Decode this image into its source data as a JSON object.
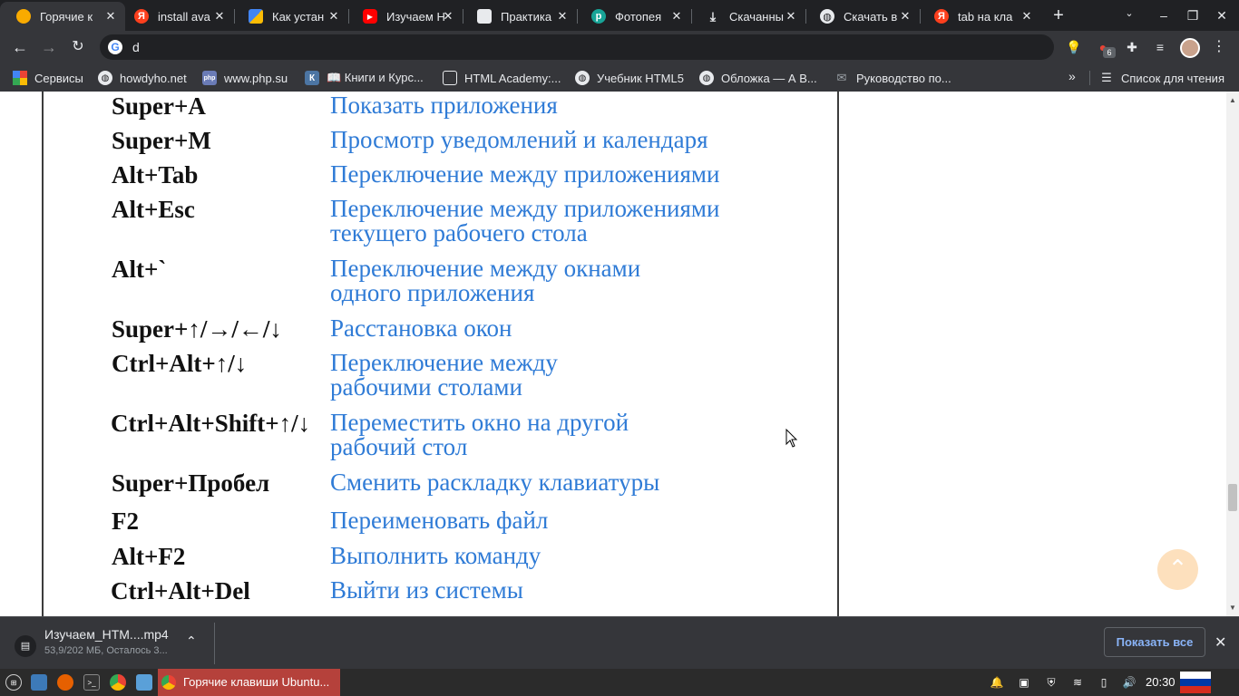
{
  "browser": {
    "tabs": [
      {
        "title": "Горячие к",
        "favicon": "bulb-icon",
        "active": true
      },
      {
        "title": "install ava",
        "favicon": "yandex-icon"
      },
      {
        "title": "Как устан",
        "favicon": "grid-icon"
      },
      {
        "title": "Изучаем H",
        "favicon": "youtube-icon"
      },
      {
        "title": "Практика",
        "favicon": "slides-icon"
      },
      {
        "title": "Фотопея",
        "favicon": "photopea-icon"
      },
      {
        "title": "Скачанны",
        "favicon": "download-icon"
      },
      {
        "title": "Скачать в",
        "favicon": "globe-icon"
      },
      {
        "title": "tab на кла",
        "favicon": "yandex-icon"
      }
    ],
    "address": "d",
    "extension_badge": "6",
    "bookmarks": [
      {
        "label": "Сервисы",
        "icon": "apps-grid-icon"
      },
      {
        "label": "howdyho.net",
        "icon": "globe-icon"
      },
      {
        "label": "www.php.su",
        "icon": "php-icon"
      },
      {
        "label": "📖 Книги и Курс...",
        "icon": "vk-icon"
      },
      {
        "label": "HTML Academy:...",
        "icon": "academy-icon"
      },
      {
        "label": "Учебник HTML5",
        "icon": "globe-icon"
      },
      {
        "label": "Обложка — А В...",
        "icon": "globe-icon"
      },
      {
        "label": "Руководство по...",
        "icon": "mail-icon"
      }
    ],
    "reading_list": "Список для чтения"
  },
  "shortcuts": [
    {
      "key": "Super+A",
      "desc": [
        "Показать приложения"
      ]
    },
    {
      "key": "Super+M",
      "desc": [
        "Просмотр уведомлений и календаря"
      ]
    },
    {
      "key": "Alt+Tab",
      "desc": [
        "Переключение между приложениями"
      ]
    },
    {
      "key": "Alt+Esc",
      "desc": [
        "Переключение между приложениями",
        "текущего рабочего стола"
      ]
    },
    {
      "key": "Alt+`",
      "desc": [
        "Переключение между окнами",
        "одного приложения"
      ]
    },
    {
      "key": "Super+↑/→/←/↓",
      "desc": [
        "Расстановка окон"
      ]
    },
    {
      "key": "Ctrl+Alt+↑/↓",
      "desc": [
        "Переключение между",
        "рабочими столами"
      ]
    },
    {
      "key": "Ctrl+Alt+Shift+↑/↓",
      "desc": [
        "Переместить окно на другой",
        "рабочий стол"
      ]
    },
    {
      "key": "Super+Пробел",
      "desc": [
        "Сменить раскладку клавиатуры"
      ]
    },
    {
      "key": "F2",
      "desc": [
        "Переименовать файл"
      ]
    },
    {
      "key": "Alt+F2",
      "desc": [
        "Выполнить команду"
      ]
    },
    {
      "key": "Ctrl+Alt+Del",
      "desc": [
        "Выйти из системы"
      ]
    }
  ],
  "download": {
    "filename": "Изучаем_HTM....mp4",
    "status": "53,9/202 МБ, Осталось 3...",
    "show_all": "Показать все"
  },
  "taskbar": {
    "active_window": "Горячие клавиши Ubuntu...",
    "clock": "20:30"
  },
  "colors": {
    "key_text": "#111111",
    "desc_text": "#2f7bd6",
    "browser_dark": "#202124",
    "toolbar": "#35363a",
    "taskbar_active": "#b5413b"
  }
}
